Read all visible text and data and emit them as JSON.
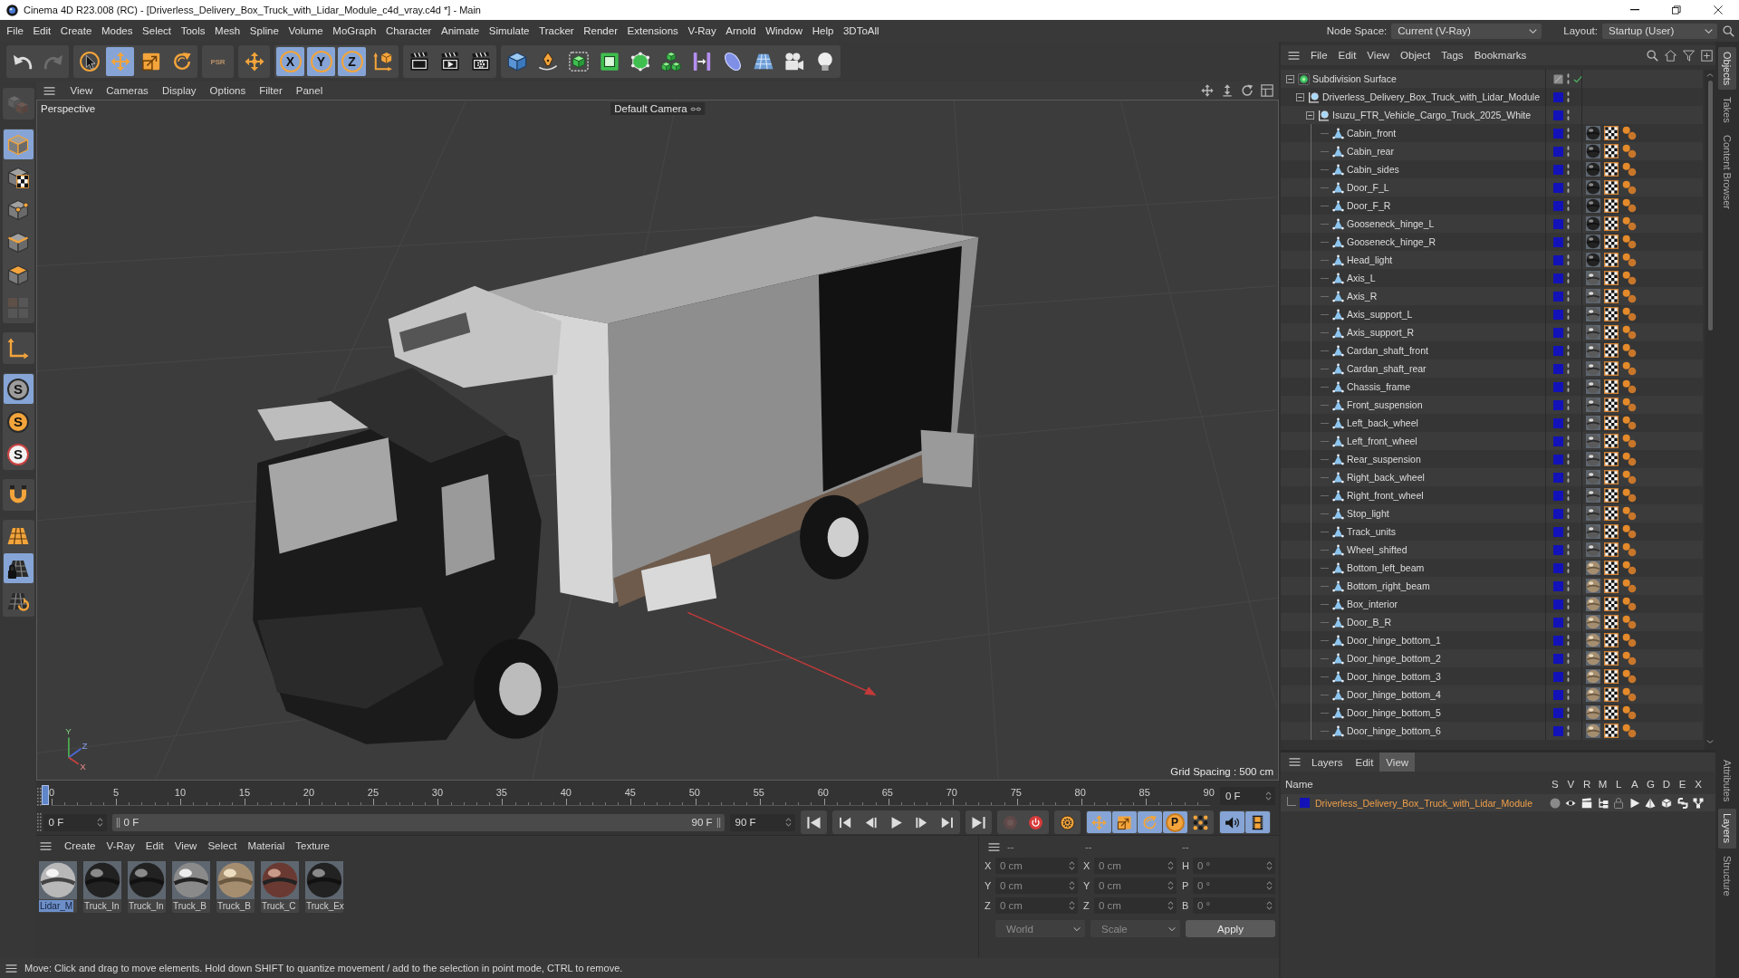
{
  "window": {
    "title": "Cinema 4D R23.008 (RC) - [Driverless_Delivery_Box_Truck_with_Lidar_Module_c4d_vray.c4d *] - Main"
  },
  "menu": [
    "File",
    "Edit",
    "Create",
    "Modes",
    "Select",
    "Tools",
    "Mesh",
    "Spline",
    "Volume",
    "MoGraph",
    "Character",
    "Animate",
    "Simulate",
    "Tracker",
    "Render",
    "Extensions",
    "V-Ray",
    "Arnold",
    "Window",
    "Help",
    "3DToAll"
  ],
  "node_space": {
    "label": "Node Space:",
    "value": "Current (V-Ray)"
  },
  "layout": {
    "label": "Layout:",
    "value": "Startup (User)"
  },
  "toolbar": [
    [
      {
        "kind": "undo",
        "selected": false,
        "disabled": false
      },
      {
        "kind": "redo",
        "selected": false,
        "disabled": true
      }
    ],
    [
      {
        "kind": "select",
        "selected": false,
        "disabled": false
      },
      {
        "kind": "move",
        "selected": true,
        "disabled": false
      },
      {
        "kind": "scale",
        "selected": false,
        "disabled": false
      },
      {
        "kind": "rotate",
        "selected": false,
        "disabled": false
      }
    ],
    [
      {
        "kind": "psr",
        "label": "PSR",
        "selected": false,
        "disabled": true
      }
    ],
    [
      {
        "kind": "place",
        "selected": false,
        "disabled": false
      }
    ],
    [
      {
        "kind": "axis",
        "label": "X",
        "selected": true,
        "disabled": false
      },
      {
        "kind": "axis",
        "label": "Y",
        "selected": true,
        "disabled": false
      },
      {
        "kind": "axis",
        "label": "Z",
        "selected": true,
        "disabled": false
      },
      {
        "kind": "coords",
        "selected": false,
        "disabled": false
      }
    ],
    [
      {
        "kind": "renderview",
        "selected": false,
        "disabled": false
      },
      {
        "kind": "render",
        "selected": false,
        "disabled": false
      },
      {
        "kind": "rendersettings",
        "selected": false,
        "disabled": false
      }
    ],
    [
      {
        "kind": "cube",
        "selected": false,
        "disabled": false
      },
      {
        "kind": "pen",
        "selected": false,
        "disabled": false
      },
      {
        "kind": "subdivide",
        "selected": false,
        "disabled": false
      },
      {
        "kind": "extrude",
        "selected": false,
        "disabled": false
      },
      {
        "kind": "cloner",
        "selected": false,
        "disabled": false
      },
      {
        "kind": "mograph",
        "selected": false,
        "disabled": false
      },
      {
        "kind": "deformer",
        "selected": false,
        "disabled": false
      },
      {
        "kind": "field",
        "selected": false,
        "disabled": false
      },
      {
        "kind": "floor",
        "selected": false,
        "disabled": false
      },
      {
        "kind": "camera",
        "selected": false,
        "disabled": false
      },
      {
        "kind": "light",
        "selected": false,
        "disabled": false
      }
    ]
  ],
  "tool_strip": [
    [
      {
        "kind": "editable",
        "selected": false,
        "disabled": true
      }
    ],
    [
      {
        "kind": "model",
        "selected": true,
        "disabled": false
      },
      {
        "kind": "texture",
        "selected": false,
        "disabled": false
      },
      {
        "kind": "points",
        "selected": false,
        "disabled": false
      },
      {
        "kind": "edges",
        "selected": false,
        "disabled": false
      },
      {
        "kind": "polygons",
        "selected": false,
        "disabled": false
      },
      {
        "kind": "uv",
        "selected": false,
        "disabled": true
      }
    ],
    [
      {
        "kind": "axismode",
        "selected": false,
        "disabled": false
      }
    ],
    [
      {
        "kind": "snap",
        "label": "S",
        "selected": true,
        "disabled": false
      },
      {
        "kind": "snap2",
        "label": "S",
        "selected": false,
        "disabled": false
      },
      {
        "kind": "snap3",
        "label": "S",
        "selected": false,
        "disabled": false
      }
    ],
    [
      {
        "kind": "magnet",
        "selected": false,
        "disabled": false
      }
    ],
    [
      {
        "kind": "workplane",
        "selected": false,
        "disabled": false
      },
      {
        "kind": "workplanelock",
        "selected": true,
        "disabled": false
      },
      {
        "kind": "workplanesync",
        "selected": false,
        "disabled": false
      }
    ]
  ],
  "viewport": {
    "menu": [
      "View",
      "Cameras",
      "Display",
      "Options",
      "Filter",
      "Panel"
    ],
    "view": "Perspective",
    "camera": "Default Camera",
    "grid_spacing": "Grid Spacing : 500 cm",
    "axes": [
      "Y",
      "Z",
      "X"
    ]
  },
  "timeline": {
    "ticks": [
      "0",
      "5",
      "10",
      "15",
      "20",
      "25",
      "30",
      "35",
      "40",
      "45",
      "50",
      "55",
      "60",
      "65",
      "70",
      "75",
      "80",
      "85",
      "90"
    ],
    "level": 0,
    "current": "0 F",
    "start": "0 F",
    "range": {
      "start": "0 F",
      "end": "90 F"
    },
    "end": "90 F"
  },
  "transport": [
    [
      {
        "kind": "start",
        "selected": false,
        "disabled": false
      }
    ],
    [
      {
        "kind": "prevkey",
        "selected": false,
        "disabled": false
      },
      {
        "kind": "prevframe",
        "selected": false,
        "disabled": false
      },
      {
        "kind": "play",
        "selected": false,
        "disabled": false
      },
      {
        "kind": "nextframe",
        "selected": false,
        "disabled": false
      },
      {
        "kind": "nextkey",
        "selected": false,
        "disabled": false
      }
    ],
    [
      {
        "kind": "end",
        "selected": false,
        "disabled": false
      }
    ],
    [
      {
        "kind": "record",
        "selected": false,
        "disabled": true
      },
      {
        "kind": "autokey",
        "selected": false,
        "disabled": false
      }
    ],
    [
      {
        "kind": "keysettings",
        "selected": false,
        "disabled": false
      }
    ],
    [
      {
        "kind": "keymove",
        "selected": true,
        "disabled": false
      },
      {
        "kind": "keyscale",
        "selected": true,
        "disabled": false
      },
      {
        "kind": "keyrotate",
        "selected": true,
        "disabled": false
      },
      {
        "kind": "keypoint",
        "label": "P",
        "selected": true,
        "disabled": false
      },
      {
        "kind": "keygrid",
        "selected": false,
        "disabled": false
      }
    ],
    [
      {
        "kind": "sound",
        "selected": true,
        "disabled": false
      },
      {
        "kind": "film",
        "selected": true,
        "disabled": false
      }
    ]
  ],
  "materials": {
    "menu": [
      "Create",
      "V-Ray",
      "Edit",
      "View",
      "Select",
      "Material",
      "Texture"
    ],
    "items": [
      {
        "name": "Lidar_M",
        "kind": "light",
        "selected": true
      },
      {
        "name": "Truck_In",
        "kind": "dark",
        "selected": false
      },
      {
        "name": "Truck_In",
        "kind": "dark",
        "selected": false
      },
      {
        "name": "Truck_B",
        "kind": "grey",
        "selected": false
      },
      {
        "name": "Truck_B",
        "kind": "tan",
        "selected": false
      },
      {
        "name": "Truck_C",
        "kind": "rust",
        "selected": false
      },
      {
        "name": "Truck_Ex",
        "kind": "dark",
        "selected": false
      }
    ]
  },
  "coordinates": {
    "headers": [
      "--",
      "--",
      "--"
    ],
    "disabled": true,
    "columns": [
      [
        {
          "axis": "X",
          "value": "0 cm"
        },
        {
          "axis": "Y",
          "value": "0 cm"
        },
        {
          "axis": "Z",
          "value": "0 cm"
        }
      ],
      [
        {
          "axis": "X",
          "value": "0 cm"
        },
        {
          "axis": "Y",
          "value": "0 cm"
        },
        {
          "axis": "Z",
          "value": "0 cm"
        }
      ],
      [
        {
          "axis": "H",
          "value": "0 °"
        },
        {
          "axis": "P",
          "value": "0 °"
        },
        {
          "axis": "B",
          "value": "0 °"
        }
      ]
    ],
    "dropdowns": [
      "World",
      "Scale"
    ],
    "apply": "Apply"
  },
  "status_bar": "Move: Click and drag to move elements. Hold down SHIFT to quantize movement / add to the selection in point mode, CTRL to remove.",
  "objects": {
    "menu": [
      "File",
      "Edit",
      "View",
      "Object",
      "Tags",
      "Bookmarks"
    ],
    "tree": [
      {
        "kind": "generator",
        "name": "Subdivision Surface",
        "enabled": true,
        "expanded": true,
        "children": [
          {
            "kind": "null",
            "name": "Driverless_Delivery_Box_Truck_with_Lidar_Module",
            "expanded": true,
            "children": [
              {
                "kind": "null",
                "name": "Isuzu_FTR_Vehicle_Cargo_Truck_2025_White",
                "expanded": true,
                "children": [
                  {
                    "kind": "polygon",
                    "name": "Cabin_front",
                    "material_tag": {
                      "kind": "dark"
                    }
                  },
                  {
                    "kind": "polygon",
                    "name": "Cabin_rear",
                    "material_tag": {
                      "kind": "dark"
                    }
                  },
                  {
                    "kind": "polygon",
                    "name": "Cabin_sides",
                    "material_tag": {
                      "kind": "dark"
                    }
                  },
                  {
                    "kind": "polygon",
                    "name": "Door_F_L",
                    "material_tag": {
                      "kind": "dark"
                    }
                  },
                  {
                    "kind": "polygon",
                    "name": "Door_F_R",
                    "material_tag": {
                      "kind": "dark"
                    }
                  },
                  {
                    "kind": "polygon",
                    "name": "Gooseneck_hinge_L",
                    "material_tag": {
                      "kind": "dark"
                    }
                  },
                  {
                    "kind": "polygon",
                    "name": "Gooseneck_hinge_R",
                    "material_tag": {
                      "kind": "dark"
                    }
                  },
                  {
                    "kind": "polygon",
                    "name": "Head_light",
                    "material_tag": {
                      "kind": "dark"
                    }
                  },
                  {
                    "kind": "polygon",
                    "name": "Axis_L",
                    "material_tag": {
                      "kind": "chrome"
                    }
                  },
                  {
                    "kind": "polygon",
                    "name": "Axis_R",
                    "material_tag": {
                      "kind": "chrome"
                    }
                  },
                  {
                    "kind": "polygon",
                    "name": "Axis_support_L",
                    "material_tag": {
                      "kind": "chrome"
                    }
                  },
                  {
                    "kind": "polygon",
                    "name": "Axis_support_R",
                    "material_tag": {
                      "kind": "chrome"
                    }
                  },
                  {
                    "kind": "polygon",
                    "name": "Cardan_shaft_front",
                    "material_tag": {
                      "kind": "chrome"
                    }
                  },
                  {
                    "kind": "polygon",
                    "name": "Cardan_shaft_rear",
                    "material_tag": {
                      "kind": "chrome"
                    }
                  },
                  {
                    "kind": "polygon",
                    "name": "Chassis_frame",
                    "material_tag": {
                      "kind": "chrome"
                    }
                  },
                  {
                    "kind": "polygon",
                    "name": "Front_suspension",
                    "material_tag": {
                      "kind": "chrome"
                    }
                  },
                  {
                    "kind": "polygon",
                    "name": "Left_back_wheel",
                    "material_tag": {
                      "kind": "chrome"
                    }
                  },
                  {
                    "kind": "polygon",
                    "name": "Left_front_wheel",
                    "material_tag": {
                      "kind": "chrome"
                    }
                  },
                  {
                    "kind": "polygon",
                    "name": "Rear_suspension",
                    "material_tag": {
                      "kind": "chrome"
                    }
                  },
                  {
                    "kind": "polygon",
                    "name": "Right_back_wheel",
                    "material_tag": {
                      "kind": "chrome"
                    }
                  },
                  {
                    "kind": "polygon",
                    "name": "Right_front_wheel",
                    "material_tag": {
                      "kind": "chrome"
                    }
                  },
                  {
                    "kind": "polygon",
                    "name": "Stop_light",
                    "material_tag": {
                      "kind": "chrome"
                    }
                  },
                  {
                    "kind": "polygon",
                    "name": "Track_units",
                    "material_tag": {
                      "kind": "chrome"
                    }
                  },
                  {
                    "kind": "polygon",
                    "name": "Wheel_shifted",
                    "material_tag": {
                      "kind": "chrome"
                    }
                  },
                  {
                    "kind": "polygon",
                    "name": "Bottom_left_beam",
                    "material_tag": {
                      "kind": "tan"
                    }
                  },
                  {
                    "kind": "polygon",
                    "name": "Bottom_right_beam",
                    "material_tag": {
                      "kind": "tan"
                    }
                  },
                  {
                    "kind": "polygon",
                    "name": "Box_interior",
                    "material_tag": {
                      "kind": "tan"
                    }
                  },
                  {
                    "kind": "polygon",
                    "name": "Door_B_R",
                    "material_tag": {
                      "kind": "tan"
                    }
                  },
                  {
                    "kind": "polygon",
                    "name": "Door_hinge_bottom_1",
                    "material_tag": {
                      "kind": "tan"
                    }
                  },
                  {
                    "kind": "polygon",
                    "name": "Door_hinge_bottom_2",
                    "material_tag": {
                      "kind": "tan"
                    }
                  },
                  {
                    "kind": "polygon",
                    "name": "Door_hinge_bottom_3",
                    "material_tag": {
                      "kind": "tan"
                    }
                  },
                  {
                    "kind": "polygon",
                    "name": "Door_hinge_bottom_4",
                    "material_tag": {
                      "kind": "tan"
                    }
                  },
                  {
                    "kind": "polygon",
                    "name": "Door_hinge_bottom_5",
                    "material_tag": {
                      "kind": "tan"
                    }
                  },
                  {
                    "kind": "polygon",
                    "name": "Door_hinge_bottom_6",
                    "material_tag": {
                      "kind": "tan"
                    }
                  }
                ]
              }
            ]
          }
        ]
      }
    ]
  },
  "layers": {
    "tabs": [
      {
        "label": "Layers",
        "selected": false
      },
      {
        "label": "Edit",
        "selected": false
      },
      {
        "label": "View",
        "selected": true
      }
    ],
    "name_header": "Name",
    "columns": [
      "S",
      "V",
      "R",
      "M",
      "L",
      "A",
      "G",
      "D",
      "E",
      "X"
    ],
    "items": [
      {
        "name": "Driverless_Delivery_Box_Truck_with_Lidar_Module",
        "solo": false,
        "visible": true,
        "render": true,
        "manager": true,
        "locked": false,
        "animation": true,
        "generators": true,
        "deformers": true,
        "expressions": true,
        "xrefs": true
      }
    ]
  },
  "side_tabs": {
    "top": [
      {
        "label": "Objects",
        "selected": true
      },
      {
        "label": "Takes",
        "selected": false
      },
      {
        "label": "Content Browser",
        "selected": false
      }
    ],
    "bottom": [
      {
        "label": "Attributes",
        "selected": false
      },
      {
        "label": "Layers",
        "selected": true
      },
      {
        "label": "Structure",
        "selected": false
      }
    ]
  }
}
